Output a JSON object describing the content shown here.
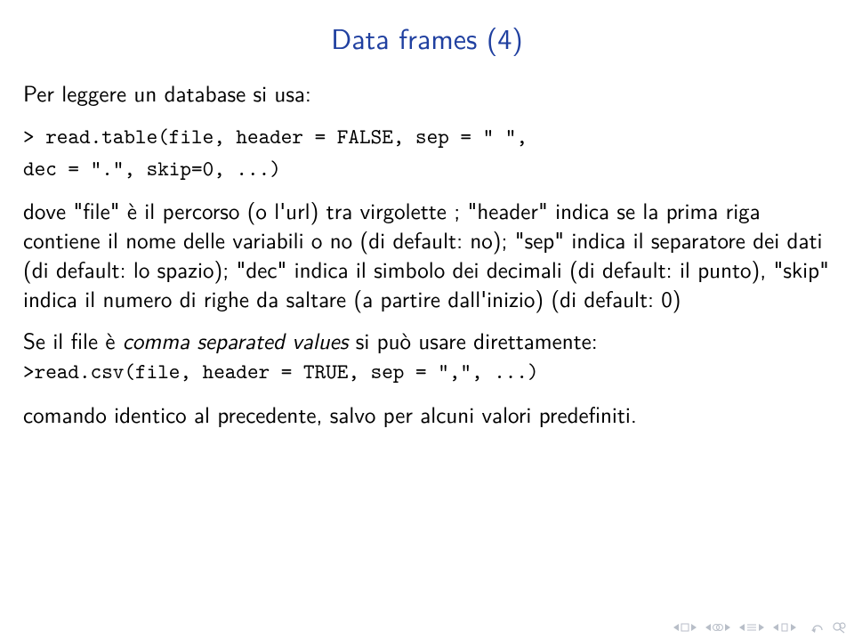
{
  "title": "Data frames (4)",
  "p1": "Per leggere un database si usa:",
  "code1_l1": "> read.table(file, header = FALSE, sep = \" \",",
  "code1_l2": "dec = \".\", skip=0, ...)",
  "p2_part1": "dove \"file\" è il percorso (o l'url) tra virgolette ; \"header\" indica se la prima riga contiene il nome delle variabili o no (di default: no); \"sep\" indica il separatore dei dati (di default: lo spazio); \"dec\" indica il simbolo dei decimali (di default: il punto), \"skip\" indica il numero di righe da saltare (a partire dall'inizio) (di default: 0)",
  "p3_a": "Se il file è ",
  "p3_ital": "comma separated values",
  "p3_b": " si può usare direttamente:",
  "code2": ">read.csv(file, header = TRUE, sep = \",\", ...)",
  "p4": "comando identico al precedente, salvo per alcuni valori predefiniti."
}
